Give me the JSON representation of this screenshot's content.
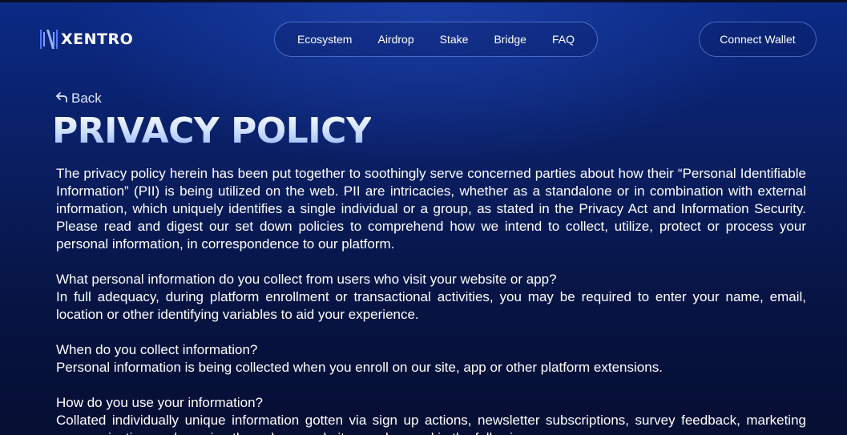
{
  "header": {
    "logo_text": "XENTRO",
    "nav": [
      "Ecosystem",
      "Airdrop",
      "Stake",
      "Bridge",
      "FAQ"
    ],
    "connect_label": "Connect Wallet"
  },
  "back_label": "Back",
  "page_title": "PRIVACY POLICY",
  "content": {
    "intro": "The privacy policy herein has been put together to soothingly serve concerned parties about how their “Personal Identifiable Information” (PII) is being utilized on the web. PII are intricacies, whether as a standalone or in combination with external information, which uniquely identifies a single individual or a group, as stated in the Privacy Act and Information Security. Please read and digest our set down policies to comprehend how we intend to collect, utilize, protect or process your personal information, in correspondence to our platform.",
    "sections": [
      {
        "question": "What personal information do you collect from users who visit your website or app?",
        "answer": "In full adequacy, during platform enrollment or transactional activities, you may be required to enter your name, email, location or other identifying variables to aid your experience."
      },
      {
        "question": "When do you collect information?",
        "answer": "Personal information is being collected when you enroll on our site, app or other platform extensions."
      },
      {
        "question": "How do you use your information?",
        "answer": "Collated individually unique information gotten via sign up actions, newsletter subscriptions, survey feedback, marketing communications or browsing through our website, can be used in the following ways:"
      }
    ]
  }
}
